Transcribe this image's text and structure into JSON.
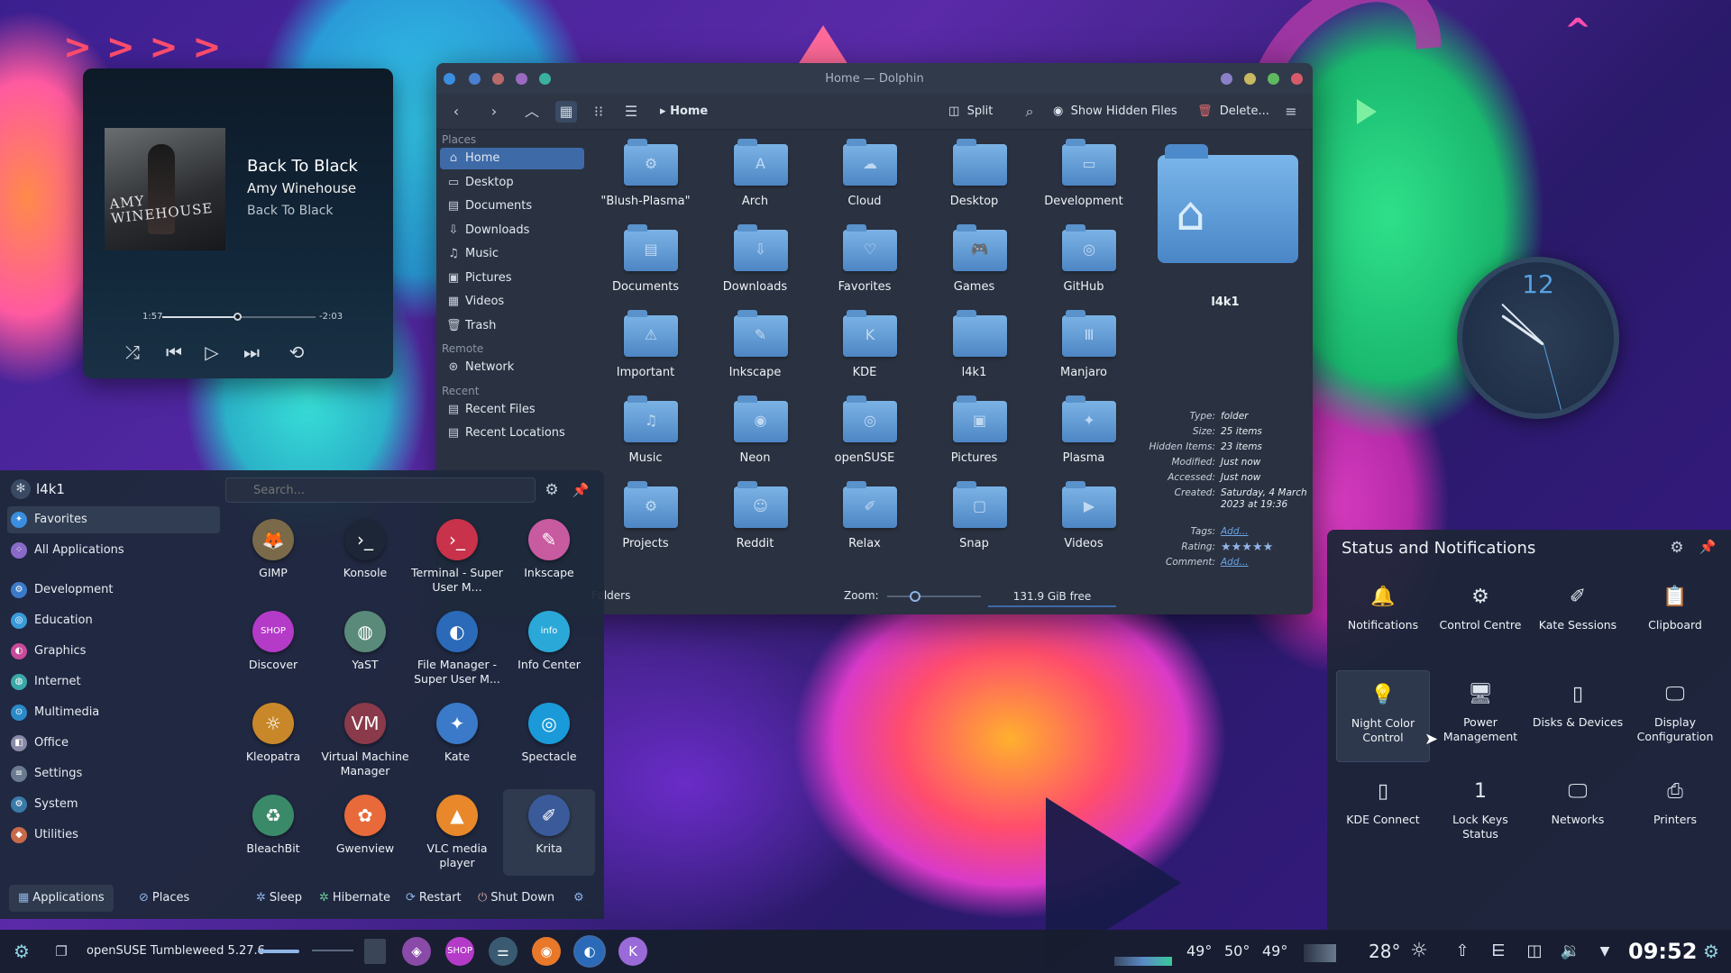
{
  "player": {
    "cover_text": "AMY WINEHOUSE",
    "title": "Back To Black",
    "artist": "Amy Winehouse",
    "album": "Back To Black",
    "elapsed": "1:57",
    "remaining": "-2:03",
    "progress": 0.49
  },
  "dolphin": {
    "window_title": "Home — Dolphin",
    "breadcrumb": "Home",
    "split_label": "Split",
    "show_hidden_label": "Show Hidden Files",
    "delete_label": "Delete...",
    "places_header": "Places",
    "places": [
      "Home",
      "Desktop",
      "Documents",
      "Downloads",
      "Music",
      "Pictures",
      "Videos",
      "Trash"
    ],
    "remote_header": "Remote",
    "remote": [
      "Network"
    ],
    "recent_header": "Recent",
    "recent": [
      "Recent Files",
      "Recent Locations"
    ],
    "folders": [
      "\"Blush-Plasma\"",
      "Arch",
      "Cloud",
      "Desktop",
      "Development",
      "Documents",
      "Downloads",
      "Favorites",
      "Games",
      "GitHub",
      "Important",
      "Inkscape",
      "KDE",
      "l4k1",
      "Manjaro",
      "Music",
      "Neon",
      "openSUSE",
      "Pictures",
      "Plasma",
      "Projects",
      "Reddit",
      "Relax",
      "Snap",
      "Videos"
    ],
    "status_left": "Folders",
    "zoom_label": "Zoom:",
    "zoom_level": 0.3,
    "free_space": "131.9 GiB free",
    "info": {
      "name": "l4k1",
      "rows": [
        {
          "k": "Type:",
          "v": "folder"
        },
        {
          "k": "Size:",
          "v": "25 items"
        },
        {
          "k": "Hidden Items:",
          "v": "23 items"
        },
        {
          "k": "Modified:",
          "v": "Just now"
        },
        {
          "k": "Accessed:",
          "v": "Just now"
        },
        {
          "k": "Created:",
          "v": "Saturday, 4 March 2023 at 19:36"
        },
        {
          "k": "Tags:",
          "v": "Add..."
        },
        {
          "k": "Rating:",
          "v": "★★★★★"
        },
        {
          "k": "Comment:",
          "v": "Add..."
        }
      ]
    }
  },
  "launcher": {
    "user": "l4k1",
    "search_placeholder": "Search...",
    "categories": [
      "Favorites",
      "All Applications",
      "Development",
      "Education",
      "Graphics",
      "Internet",
      "Multimedia",
      "Office",
      "Settings",
      "System",
      "Utilities"
    ],
    "apps": [
      {
        "label": "GIMP",
        "icon": "gimp-icon",
        "color": "#7a6a4a"
      },
      {
        "label": "Konsole",
        "icon": "konsole-icon",
        "color": "#1c2636"
      },
      {
        "label": "Terminal - Super User M...",
        "icon": "terminal-su-icon",
        "color": "#c8324a"
      },
      {
        "label": "Inkscape",
        "icon": "inkscape-icon",
        "color": "#c85aa0"
      },
      {
        "label": "Discover",
        "icon": "discover-icon",
        "color": "#b43ac8"
      },
      {
        "label": "YaST",
        "icon": "yast-icon",
        "color": "#5a8a7a"
      },
      {
        "label": "File Manager - Super User M...",
        "icon": "file-manager-su-icon",
        "color": "#2a6ab8"
      },
      {
        "label": "Info Center",
        "icon": "info-center-icon",
        "color": "#2aa8d8"
      },
      {
        "label": "Kleopatra",
        "icon": "kleopatra-icon",
        "color": "#c8882a"
      },
      {
        "label": "Virtual Machine Manager",
        "icon": "virt-manager-icon",
        "color": "#8a3a4a"
      },
      {
        "label": "Kate",
        "icon": "kate-icon",
        "color": "#3a7ac8"
      },
      {
        "label": "Spectacle",
        "icon": "spectacle-icon",
        "color": "#1a9ad8"
      },
      {
        "label": "BleachBit",
        "icon": "bleachbit-icon",
        "color": "#3a8a6a"
      },
      {
        "label": "Gwenview",
        "icon": "gwenview-icon",
        "color": "#e86a3a"
      },
      {
        "label": "VLC media player",
        "icon": "vlc-icon",
        "color": "#e8882a"
      },
      {
        "label": "Krita",
        "icon": "krita-icon",
        "color": "#3a5a9a"
      }
    ],
    "footer": {
      "applications": "Applications",
      "places": "Places",
      "sleep": "Sleep",
      "hibernate": "Hibernate",
      "restart": "Restart",
      "shutdown": "Shut Down"
    }
  },
  "status_notifications": {
    "title": "Status and Notifications",
    "items": [
      {
        "label": "Notifications",
        "icon": "bell-icon"
      },
      {
        "label": "Control Centre",
        "icon": "gear-icon"
      },
      {
        "label": "Kate Sessions",
        "icon": "kate-sessions-icon"
      },
      {
        "label": "Clipboard",
        "icon": "clipboard-icon"
      },
      {
        "label": "Night Color Control",
        "icon": "lightbulb-icon"
      },
      {
        "label": "Power Management",
        "icon": "power-management-icon"
      },
      {
        "label": "Disks & Devices",
        "icon": "usb-drive-icon"
      },
      {
        "label": "Display Configuration",
        "icon": "display-icon"
      },
      {
        "label": "KDE Connect",
        "icon": "phone-icon"
      },
      {
        "label": "Lock Keys Status",
        "icon": "lock-keys-icon"
      },
      {
        "label": "Networks",
        "icon": "network-icon"
      },
      {
        "label": "Printers",
        "icon": "printer-icon"
      }
    ]
  },
  "clock": {
    "numeral": "12"
  },
  "taskbar": {
    "os_label": "openSUSE Tumbleweed 5.27.6",
    "temps": [
      "49°",
      "50°",
      "49°"
    ],
    "weather": "28°",
    "time": "09:52"
  }
}
